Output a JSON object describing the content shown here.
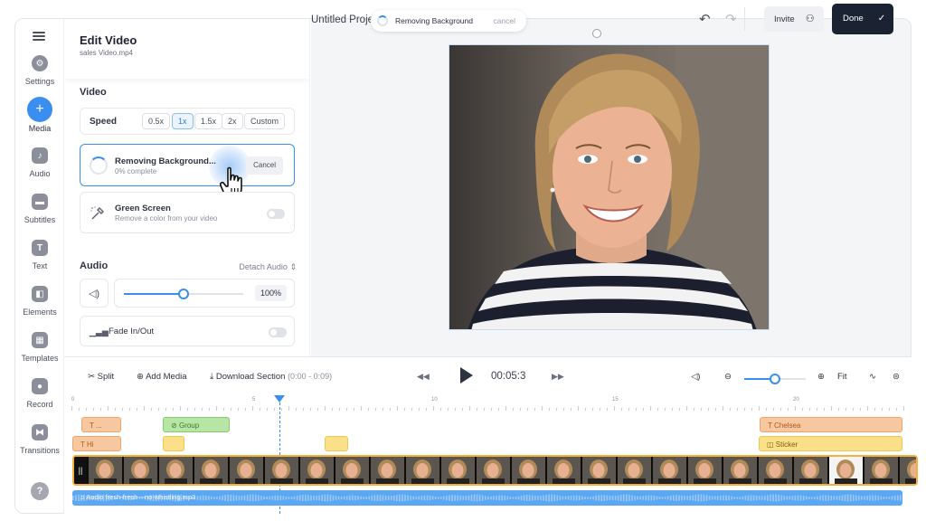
{
  "rail": {
    "items": [
      {
        "label": "Settings",
        "icon": "gear-icon"
      },
      {
        "label": "Media",
        "icon": "plus-icon",
        "active": true
      },
      {
        "label": "Audio",
        "icon": "music-note-icon"
      },
      {
        "label": "Subtitles",
        "icon": "subtitles-icon"
      },
      {
        "label": "Text",
        "icon": "text-icon"
      },
      {
        "label": "Elements",
        "icon": "elements-icon"
      },
      {
        "label": "Templates",
        "icon": "templates-icon"
      },
      {
        "label": "Record",
        "icon": "record-icon"
      },
      {
        "label": "Transitions",
        "icon": "transitions-icon"
      }
    ],
    "help": "?"
  },
  "panel": {
    "title": "Edit Video",
    "filename": "sales Video.mp4",
    "video_section": "Video",
    "speed": {
      "label": "Speed",
      "options": [
        "0.5x",
        "1x",
        "1.5x",
        "2x",
        "Custom"
      ],
      "selected": "1x"
    },
    "remove_bg": {
      "title": "Removing Background...",
      "progress": "0% complete",
      "cancel": "Cancel"
    },
    "green_screen": {
      "title": "Green Screen",
      "subtitle": "Remove a color from your video",
      "enabled": false
    },
    "audio_section": "Audio",
    "detach_audio": "Detach Audio",
    "volume": {
      "value_label": "100%",
      "level": 0.5
    },
    "fade": {
      "label": "Fade In/Out",
      "enabled": false
    }
  },
  "topbar": {
    "project_title": "Untitled Proje",
    "toast": {
      "text": "Removing Background",
      "cancel": "cancel"
    },
    "invite": "Invite",
    "done": "Done"
  },
  "timeline": {
    "split": "Split",
    "add_media": "Add Media",
    "download": "Download Section",
    "download_range": "(0:00 - 0:09)",
    "timecode": "00:05:3",
    "fit": "Fit",
    "zoom_level": 0.5,
    "ruler_labels": [
      "0",
      "5",
      "10",
      "15",
      "20"
    ],
    "clips_row1": [
      {
        "label": "T ...",
        "kind": "text"
      },
      {
        "label": "Group",
        "kind": "group"
      },
      {
        "label": "Chelsea",
        "kind": "text"
      }
    ],
    "clips_row2": [
      {
        "label": "Hi",
        "kind": "text"
      },
      {
        "label": "",
        "kind": "yellow"
      },
      {
        "label": "",
        "kind": "yellow"
      },
      {
        "label": "Sticker",
        "kind": "yellow"
      }
    ],
    "audio_file": "Audio fresh-fresh---no-whistling.mp3"
  },
  "colors": {
    "accent": "#3a8ef0",
    "done_bg": "#1b2333",
    "text_clip": "#f7c8a0",
    "group_clip": "#b6e5a6",
    "sticker_clip": "#fbe08a",
    "audio_track": "#5ba7f2",
    "video_border": "#f5b23a"
  }
}
